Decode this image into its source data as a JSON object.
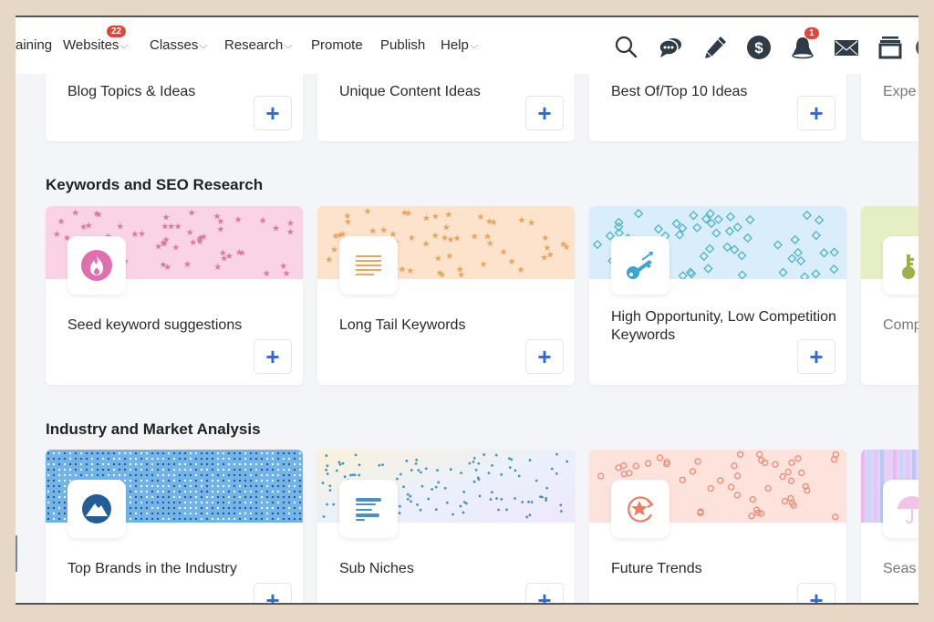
{
  "topnav": {
    "items": [
      {
        "label": "aining",
        "dropdown": false
      },
      {
        "label": "Websites",
        "dropdown": true,
        "badge": "22"
      },
      {
        "label": "Classes",
        "dropdown": true
      },
      {
        "label": "Research",
        "dropdown": true
      },
      {
        "label": "Promote",
        "dropdown": false
      },
      {
        "label": "Publish",
        "dropdown": false
      },
      {
        "label": "Help",
        "dropdown": true
      }
    ],
    "chevron": "⌵",
    "icons": [
      {
        "name": "search-icon"
      },
      {
        "name": "chat-icon"
      },
      {
        "name": "pencil-icon"
      },
      {
        "name": "dollar-icon",
        "glyph": "$"
      },
      {
        "name": "bell-icon",
        "badge": "1"
      },
      {
        "name": "mail-icon"
      },
      {
        "name": "archive-icon"
      }
    ]
  },
  "colors": {
    "accent": "#2f6ad6",
    "badge": "#e2453c",
    "page_bg": "#f3f5f8"
  },
  "rows": [
    {
      "title": "",
      "cards": [
        {
          "title": "Blog Topics & Ideas",
          "plus": "+"
        },
        {
          "title": "Unique Content Ideas",
          "plus": "+"
        },
        {
          "title": "Best Of/Top 10 Ideas",
          "plus": "+"
        },
        {
          "title": "Expe",
          "plus": "+"
        }
      ]
    },
    {
      "title": "Keywords and SEO Research",
      "cards": [
        {
          "title": "Seed keyword suggestions",
          "icon": "flame-icon",
          "plus": "+"
        },
        {
          "title": "Long Tail Keywords",
          "icon": "lines-icon",
          "plus": "+"
        },
        {
          "title": "High Opportunity, Low Competition Keywords",
          "icon": "key-arrow-icon",
          "plus": "+"
        },
        {
          "title": "Comp",
          "icon": "key-icon",
          "plus": "+"
        }
      ]
    },
    {
      "title": "Industry and Market Analysis",
      "cards": [
        {
          "title": "Top Brands in the Industry",
          "icon": "mountain-icon",
          "plus": "+"
        },
        {
          "title": "Sub Niches",
          "icon": "list-icon",
          "plus": "+"
        },
        {
          "title": "Future Trends",
          "icon": "star-refresh-icon",
          "plus": "+"
        },
        {
          "title": "Seas",
          "icon": "umbrella-icon",
          "plus": "+"
        }
      ]
    }
  ]
}
